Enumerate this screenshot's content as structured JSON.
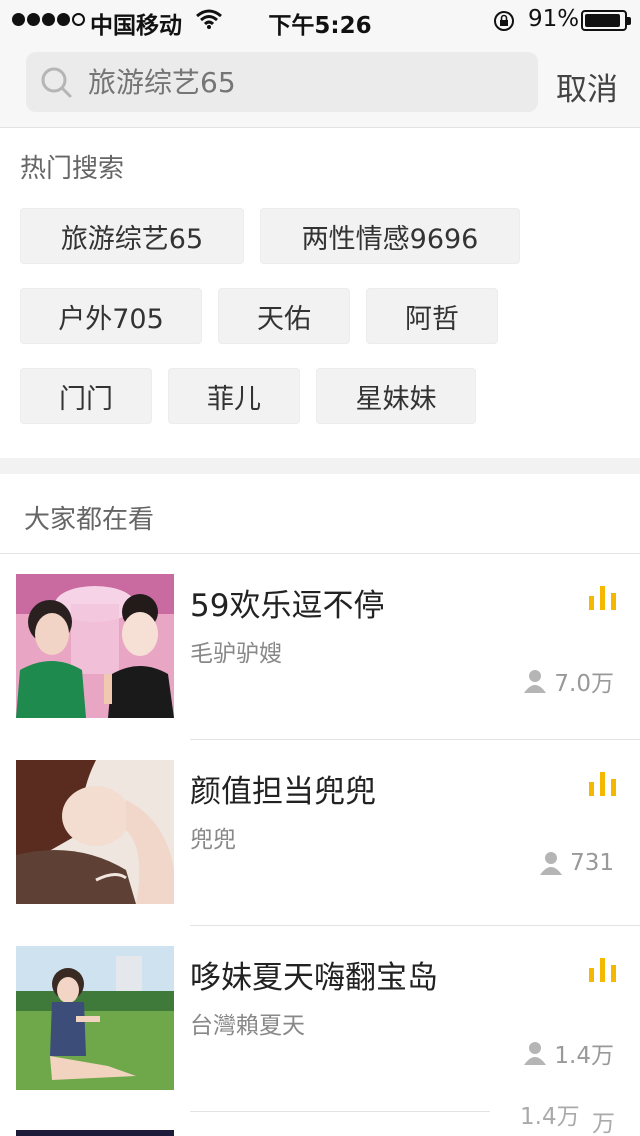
{
  "status_bar": {
    "carrier": "中国移动",
    "time": "下午5:26",
    "battery_pct": "91%",
    "battery_level": 0.91
  },
  "search": {
    "placeholder": "旅游综艺65",
    "cancel_label": "取消"
  },
  "hot_search": {
    "title": "热门搜索",
    "tags": [
      "旅游综艺65",
      "两性情感9696",
      "户外705",
      "天佑",
      "阿哲",
      "门门",
      "菲儿",
      "星妹妹"
    ]
  },
  "watching": {
    "title": "大家都在看",
    "items": [
      {
        "title": "59欢乐逗不停",
        "host": "毛驴驴嫂",
        "viewers": "7.0万"
      },
      {
        "title": "颜值担当兜兜",
        "host": "兜兜",
        "viewers": "731"
      },
      {
        "title": "哆妹夏天嗨翻宝岛",
        "host": "台灣賴夏天",
        "viewers": "1.4万"
      }
    ],
    "ghost_viewers": "1.4万",
    "ghost_unit": "万"
  },
  "colors": {
    "accent_bars": "#f5b800",
    "header_bg": "#f7f7f7",
    "chip_bg": "#f2f2f2"
  },
  "icons": {
    "search": "search-icon",
    "live": "live-bars-icon",
    "viewers": "person-icon",
    "wifi": "wifi-icon",
    "lock": "rotation-lock-icon",
    "battery": "battery-icon"
  }
}
